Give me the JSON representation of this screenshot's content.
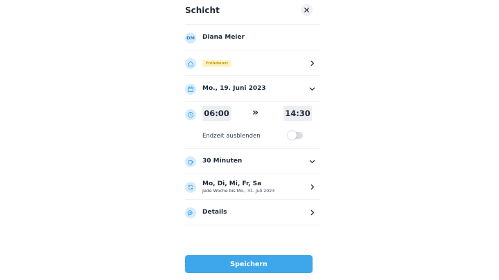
{
  "dialog": {
    "title": "Schicht"
  },
  "employee": {
    "initials": "DM",
    "name": "Diana Meier"
  },
  "shift_type": {
    "badge": "Frühdienst"
  },
  "date": {
    "label": "Mo., 19. Juni 2023"
  },
  "time": {
    "start": "06:00",
    "separator": "»",
    "end": "14:30"
  },
  "end_time_toggle": {
    "label": "Endzeit ausblenden",
    "enabled": false
  },
  "break": {
    "label": "30 Minuten"
  },
  "recurrence": {
    "days": "Mo, Di, Mi, Fr, Sa",
    "detail": "Jede Woche bis Mo., 31. Juli 2023"
  },
  "details": {
    "label": "Details"
  },
  "footer": {
    "save_label": "Speichern"
  },
  "colors": {
    "accent": "#3ea7ec",
    "icon_bg": "#d6ecfb",
    "badge_bg": "#fdf3c4",
    "badge_text": "#c99a12"
  }
}
